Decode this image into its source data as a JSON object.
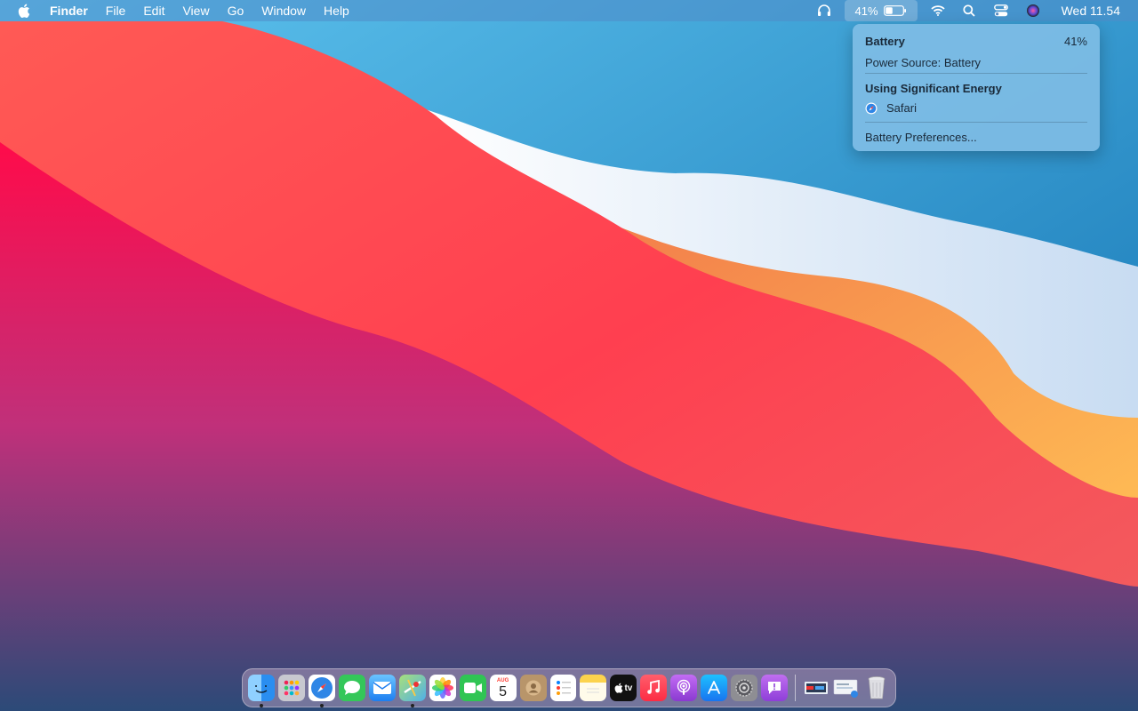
{
  "menubar": {
    "items": [
      "Finder",
      "File",
      "Edit",
      "View",
      "Go",
      "Window",
      "Help"
    ],
    "battery_percent": "41%",
    "battery_level": 0.41,
    "clock": "Wed 11.54",
    "icons": [
      "apple-logo-icon",
      "headphones-icon",
      "battery-icon",
      "wifi-icon",
      "search-icon",
      "control-center-icon",
      "siri-icon"
    ]
  },
  "battery_popup": {
    "title": "Battery",
    "percent": "41%",
    "power_source": "Power Source: Battery",
    "section_title": "Using Significant Energy",
    "apps": [
      "Safari"
    ],
    "preferences_label": "Battery Preferences..."
  },
  "dock": {
    "apps": [
      {
        "name": "Finder",
        "color": "#3aa0f0",
        "running": true
      },
      {
        "name": "Launchpad",
        "color": "#c0c0c8",
        "running": false
      },
      {
        "name": "Safari",
        "color": "#2f86e6",
        "running": true
      },
      {
        "name": "Messages",
        "color": "#34c759",
        "running": false
      },
      {
        "name": "Mail",
        "color": "#2a8bf0",
        "running": false
      },
      {
        "name": "Maps",
        "color": "#5cc25c",
        "running": true
      },
      {
        "name": "Photos",
        "color": "#f5f5f5",
        "running": false
      },
      {
        "name": "FaceTime",
        "color": "#2fc553",
        "running": false
      },
      {
        "name": "Calendar",
        "color": "#ffffff",
        "running": false
      },
      {
        "name": "Contacts",
        "color": "#b8956a",
        "running": false
      },
      {
        "name": "Reminders",
        "color": "#ffffff",
        "running": false
      },
      {
        "name": "Notes",
        "color": "#fce590",
        "running": false
      },
      {
        "name": "TV",
        "color": "#111111",
        "running": false
      },
      {
        "name": "Music",
        "color": "#fc3c44",
        "running": false
      },
      {
        "name": "Podcasts",
        "color": "#9b4fd8",
        "running": false
      },
      {
        "name": "App Store",
        "color": "#1e8ef7",
        "running": false
      },
      {
        "name": "System Preferences",
        "color": "#8e8e93",
        "running": false
      },
      {
        "name": "Feedback Assistant",
        "color": "#a855d8",
        "running": false
      }
    ],
    "calendar": {
      "month": "AUG",
      "day": "5"
    },
    "tv_label": "tv",
    "right_items": [
      "Downloads",
      "Documents",
      "Trash"
    ]
  }
}
